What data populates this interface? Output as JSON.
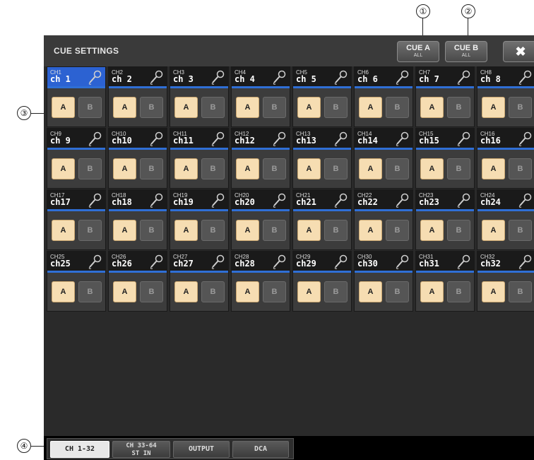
{
  "window": {
    "title": "CUE SETTINGS"
  },
  "header": {
    "cue_a": {
      "label": "CUE A",
      "sub": "ALL"
    },
    "cue_b": {
      "label": "CUE B",
      "sub": "ALL"
    },
    "close_glyph": "✖"
  },
  "button_labels": {
    "a": "A",
    "b": "B"
  },
  "channels": [
    {
      "num": "CH1",
      "name": "ch 1"
    },
    {
      "num": "CH2",
      "name": "ch 2"
    },
    {
      "num": "CH3",
      "name": "ch 3"
    },
    {
      "num": "CH4",
      "name": "ch 4"
    },
    {
      "num": "CH5",
      "name": "ch 5"
    },
    {
      "num": "CH6",
      "name": "ch 6"
    },
    {
      "num": "CH7",
      "name": "ch 7"
    },
    {
      "num": "CH8",
      "name": "ch 8"
    },
    {
      "num": "CH9",
      "name": "ch 9"
    },
    {
      "num": "CH10",
      "name": "ch10"
    },
    {
      "num": "CH11",
      "name": "ch11"
    },
    {
      "num": "CH12",
      "name": "ch12"
    },
    {
      "num": "CH13",
      "name": "ch13"
    },
    {
      "num": "CH14",
      "name": "ch14"
    },
    {
      "num": "CH15",
      "name": "ch15"
    },
    {
      "num": "CH16",
      "name": "ch16"
    },
    {
      "num": "CH17",
      "name": "ch17"
    },
    {
      "num": "CH18",
      "name": "ch18"
    },
    {
      "num": "CH19",
      "name": "ch19"
    },
    {
      "num": "CH20",
      "name": "ch20"
    },
    {
      "num": "CH21",
      "name": "ch21"
    },
    {
      "num": "CH22",
      "name": "ch22"
    },
    {
      "num": "CH23",
      "name": "ch23"
    },
    {
      "num": "CH24",
      "name": "ch24"
    },
    {
      "num": "CH25",
      "name": "ch25"
    },
    {
      "num": "CH26",
      "name": "ch26"
    },
    {
      "num": "CH27",
      "name": "ch27"
    },
    {
      "num": "CH28",
      "name": "ch28"
    },
    {
      "num": "CH29",
      "name": "ch29"
    },
    {
      "num": "CH30",
      "name": "ch30"
    },
    {
      "num": "CH31",
      "name": "ch31"
    },
    {
      "num": "CH32",
      "name": "ch32"
    }
  ],
  "tabs": [
    {
      "line1": "CH 1-32",
      "line2": ""
    },
    {
      "line1": "CH 33-64",
      "line2": "ST IN"
    },
    {
      "line1": "OUTPUT",
      "line2": ""
    },
    {
      "line1": "DCA",
      "line2": ""
    }
  ],
  "callouts": [
    "①",
    "②",
    "③",
    "④"
  ],
  "colors": {
    "cue_a_on": "#f6ddb2",
    "selected_channel": "#2c62d2",
    "channel_accent": "#2f6fd6"
  },
  "icons": {
    "channel_icon": "microphone-icon"
  }
}
